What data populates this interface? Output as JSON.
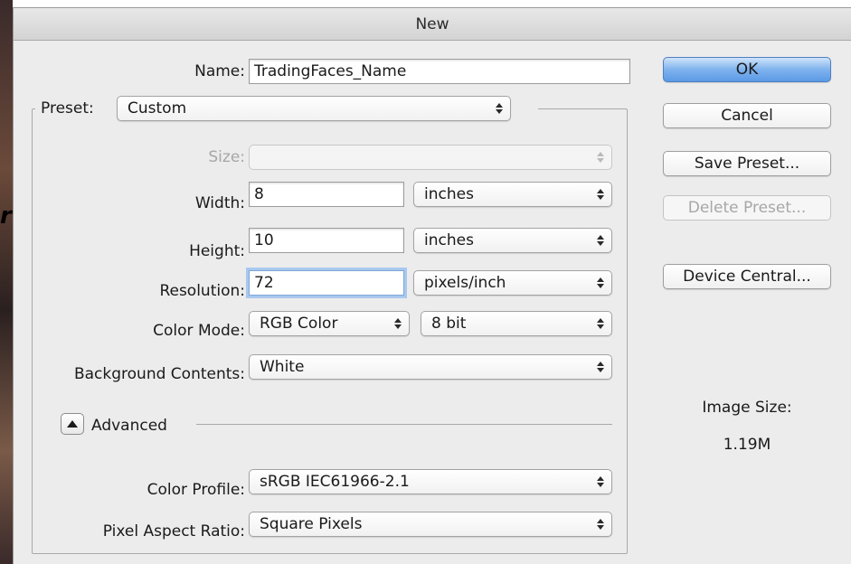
{
  "window": {
    "title": "New"
  },
  "form": {
    "name_label": "Name:",
    "name_value": "TradingFaces_Name",
    "preset_label": "Preset:",
    "preset_value": "Custom",
    "size_label": "Size:",
    "size_value": "",
    "width_label": "Width:",
    "width_value": "8",
    "width_unit": "inches",
    "height_label": "Height:",
    "height_value": "10",
    "height_unit": "inches",
    "resolution_label": "Resolution:",
    "resolution_value": "72",
    "resolution_unit": "pixels/inch",
    "color_mode_label": "Color Mode:",
    "color_mode_value": "RGB Color",
    "bit_depth_value": "8 bit",
    "background_label": "Background Contents:",
    "background_value": "White",
    "advanced_label": "Advanced",
    "color_profile_label": "Color Profile:",
    "color_profile_value": "sRGB IEC61966-2.1",
    "pixel_aspect_label": "Pixel Aspect Ratio:",
    "pixel_aspect_value": "Square Pixels"
  },
  "buttons": {
    "ok": "OK",
    "cancel": "Cancel",
    "save_preset": "Save Preset...",
    "delete_preset": "Delete Preset...",
    "device_central": "Device Central..."
  },
  "info": {
    "image_size_label": "Image Size:",
    "image_size_value": "1.19M"
  },
  "background": {
    "scrawl_text": "r"
  },
  "colors": {
    "dialog_bg": "#ececec",
    "default_button": "#5b9ae6",
    "focus_ring": "#a9c8ee",
    "disabled_text": "#a7a7a7"
  }
}
